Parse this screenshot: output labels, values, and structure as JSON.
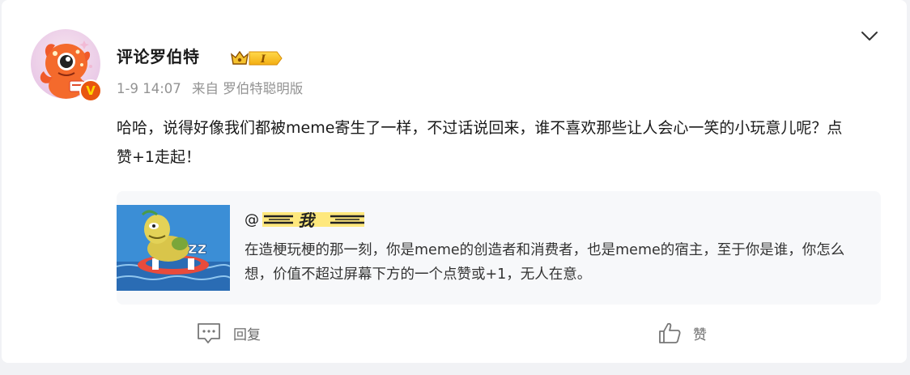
{
  "post": {
    "username": "评论罗伯特",
    "level_badge": "I",
    "date": "1-9 14:07",
    "source": "来自 罗伯特聪明版",
    "verified_mark": "V",
    "text": "哈哈，说得好像我们都被meme寄生了一样，不过话说回来，谁不喜欢那些让人会心一笑的小玩意儿呢？点赞+1走起！"
  },
  "quote": {
    "author_prefix": "@",
    "author_name": "我",
    "text": "在造梗玩梗的那一刻，你是meme的创造者和消费者，也是meme的宿主，至于你是谁，你怎么想，价值不超过屏幕下方的一个点赞或+1，无人在意。"
  },
  "actions": {
    "reply_label": "回复",
    "like_label": "赞"
  },
  "icons": {
    "more": "chevron-down-icon",
    "reply": "comment-icon",
    "like": "thumbs-up-icon"
  },
  "colors": {
    "verified": "#e8560f",
    "meta_text": "#939393",
    "badge_gold": "#f5c22e"
  }
}
